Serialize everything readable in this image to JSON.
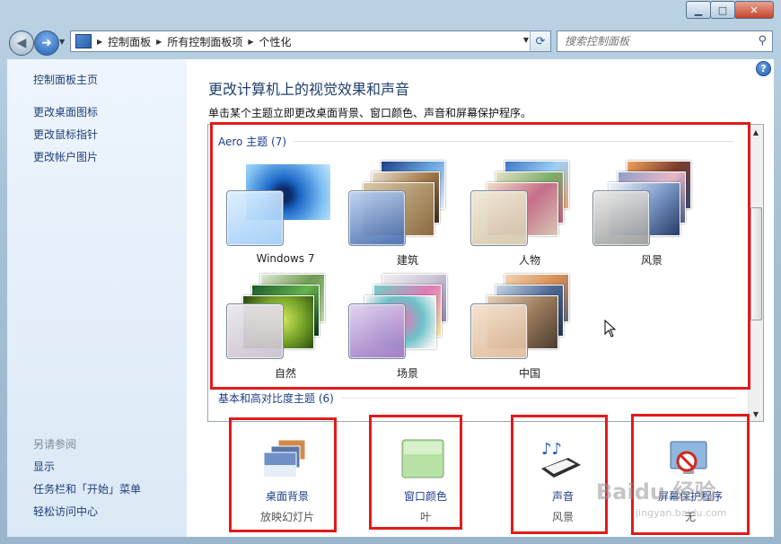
{
  "window": {
    "minimize": "▁",
    "maximize": "□",
    "close": "✕"
  },
  "address": {
    "crumbs": [
      "控制面板",
      "所有控制面板项",
      "个性化"
    ]
  },
  "search": {
    "placeholder": "搜索控制面板"
  },
  "sidebar": {
    "items": [
      {
        "label": "控制面板主页"
      },
      {
        "label": "更改桌面图标"
      },
      {
        "label": "更改鼠标指针"
      },
      {
        "label": "更改帐户图片"
      }
    ],
    "see_also_header": "另请参阅",
    "see_also": [
      {
        "label": "显示"
      },
      {
        "label": "任务栏和「开始」菜单"
      },
      {
        "label": "轻松访问中心"
      }
    ]
  },
  "main": {
    "help": "?",
    "title": "更改计算机上的视觉效果和声音",
    "subtitle": "单击某个主题立即更改桌面背景、窗口颜色、声音和屏幕保护程序。",
    "aero_group": "Aero 主题 (7)",
    "basic_group": "基本和高对比度主题 (6)",
    "themes": [
      {
        "name": "Windows 7"
      },
      {
        "name": "建筑"
      },
      {
        "name": "人物"
      },
      {
        "name": "风景"
      },
      {
        "name": "自然"
      },
      {
        "name": "场景"
      },
      {
        "name": "中国"
      }
    ]
  },
  "options": [
    {
      "label": "桌面背景",
      "value": "放映幻灯片"
    },
    {
      "label": "窗口颜色",
      "value": "叶"
    },
    {
      "label": "声音",
      "value": "风景"
    },
    {
      "label": "屏幕保护程序",
      "value": "无"
    }
  ],
  "watermark": {
    "logo": "Baidu 经验",
    "url": "jingyan.baidu.com"
  },
  "colors": {
    "accent": "#1e3f8a",
    "highlight_box": "#e01b1b"
  }
}
